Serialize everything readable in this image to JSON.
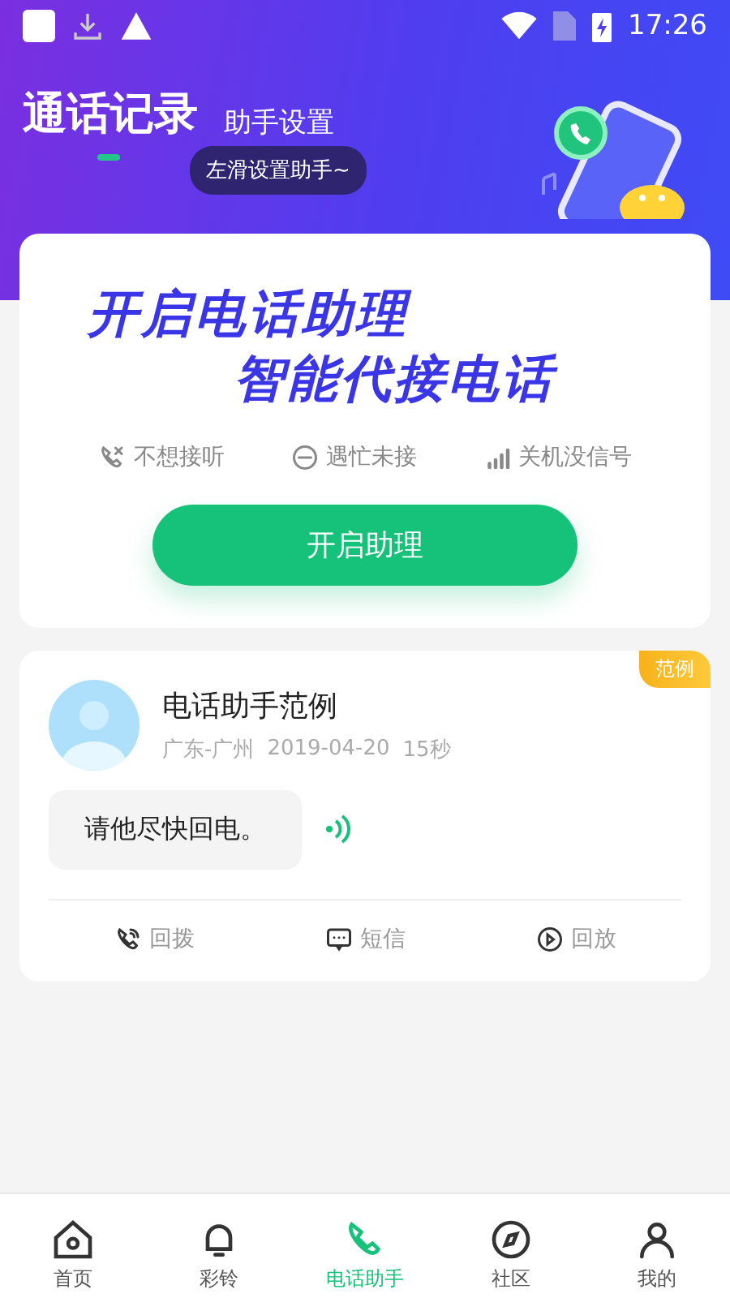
{
  "status_bar": {
    "time": "17:26"
  },
  "header": {
    "tabs": [
      {
        "label": "通话记录",
        "selected": true
      },
      {
        "label": "助手设置",
        "selected": false
      }
    ],
    "tooltip": "左滑设置助手~"
  },
  "promo": {
    "headline": "开启电话助理",
    "subline": "智能代接电话",
    "features": [
      {
        "kind": "decline",
        "label": "不想接听"
      },
      {
        "kind": "busy",
        "label": "遇忙未接"
      },
      {
        "kind": "signal",
        "label": "关机没信号"
      }
    ],
    "button": "开启助理"
  },
  "example": {
    "badge": "范例",
    "name": "电话助手范例",
    "location": "广东-广州",
    "date": "2019-04-20",
    "duration": "15秒",
    "message": "请他尽快回电。",
    "actions": [
      {
        "kind": "callback",
        "label": "回拨"
      },
      {
        "kind": "sms",
        "label": "短信"
      },
      {
        "kind": "playback",
        "label": "回放"
      }
    ]
  },
  "nav": [
    {
      "kind": "home",
      "label": "首页",
      "selected": false
    },
    {
      "kind": "ring",
      "label": "彩铃",
      "selected": false
    },
    {
      "kind": "assistant",
      "label": "电话助手",
      "selected": true
    },
    {
      "kind": "community",
      "label": "社区",
      "selected": false
    },
    {
      "kind": "me",
      "label": "我的",
      "selected": false
    }
  ]
}
